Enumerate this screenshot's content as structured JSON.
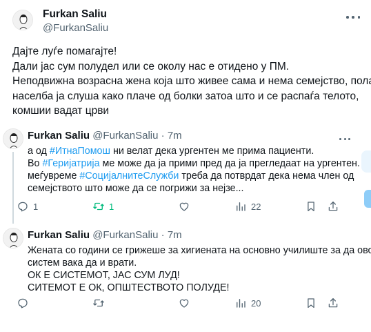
{
  "main": {
    "name": "Furkan Saliu",
    "handle": "@FurkanSaliu",
    "lines": [
      "Дајте луѓе помагајте!",
      "Дали јас сум полудел или се околу нас е отидено у ПМ.",
      "Неподвижна возрасна жена која што живее сама и нема семејство, пола",
      "населба ја слуша како плаче од болки затоа што и се распаѓа телото,",
      "комшии вадат црви"
    ]
  },
  "reply1": {
    "name": "Furkan Saliu",
    "handle": "@FurkanSaliu",
    "sep": "·",
    "time": "7m",
    "line1_pre": "а од ",
    "line1_tag": "#ИтнаПомош",
    "line1_post": " ни велат дека ургентен ме прима пациенти.",
    "line2_pre": "Во ",
    "line2_tag": "#Геријатрија",
    "line2_post": " ме може да ја прими пред да ја прегледаат на ургентен. Во",
    "line3_pre": "меѓувреме ",
    "line3_tag": "#СоцијалнитеСлужби",
    "line3_post": " треба да потврдат дека нема член од",
    "line4": "семејството што може да се погрижи за нејзе...",
    "reply_count": "1",
    "retweet_count": "1",
    "views_count": "22"
  },
  "reply2": {
    "name": "Furkan Saliu",
    "handle": "@FurkanSaliu",
    "sep": "·",
    "time": "7m",
    "lines": [
      "Жената со години се грижеше за хигиената на основно училиште за да овој",
      "систем вака да и врати.",
      "ОК Е СИСТЕМОТ, ЈАС СУМ ЛУД!",
      "СИТЕМОТ Е ОК, ОПШТЕСТВОТО ПОЛУДЕ!"
    ],
    "views_count": "20"
  },
  "colors": {
    "accent": "#1d9bf0",
    "muted": "#536471",
    "retweet": "#00ba7c",
    "text": "#0f1419"
  },
  "icons": [
    "more-icon",
    "reply-icon",
    "retweet-icon",
    "like-icon",
    "views-icon",
    "bookmark-icon",
    "share-icon"
  ]
}
